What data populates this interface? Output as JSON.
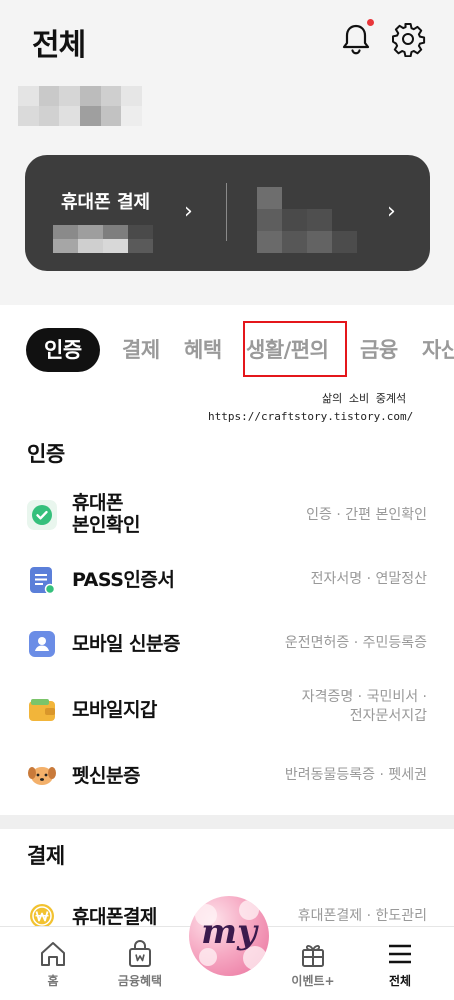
{
  "header": {
    "title": "전체"
  },
  "card": {
    "label": "휴대폰 결제",
    "chevron": "›"
  },
  "tabs": [
    {
      "label": "인증",
      "active": true
    },
    {
      "label": "결제"
    },
    {
      "label": "혜택"
    },
    {
      "label": "생활/편의",
      "highlighted": true
    },
    {
      "label": "금융"
    },
    {
      "label": "자산"
    }
  ],
  "watermark": {
    "line1": "삶의 소비 중계석",
    "line2": "https://craftstory.tistory.com/"
  },
  "sections": {
    "auth": {
      "title": "인증",
      "items": [
        {
          "label": "휴대폰\n본인확인",
          "desc": "인증 · 간편 본인확인",
          "icon": "check-shield-icon"
        },
        {
          "label": "PASS인증서",
          "desc": "전자서명 · 연말정산",
          "icon": "document-icon"
        },
        {
          "label": "모바일 신분증",
          "desc": "운전면허증 · 주민등록증",
          "icon": "id-card-icon"
        },
        {
          "label": "모바일지갑",
          "desc": "자격증명 · 국민비서 ·\n전자문서지갑",
          "icon": "wallet-icon"
        },
        {
          "label": "펫신분증",
          "desc": "반려동물등록증 · 펫세권",
          "icon": "dog-icon"
        }
      ]
    },
    "payment": {
      "title": "결제",
      "items": [
        {
          "label": "휴대폰결제",
          "desc": "휴대폰결제 · 한도관리",
          "icon": "won-coin-icon"
        }
      ]
    }
  },
  "badge": {
    "text": "my"
  },
  "nav": [
    {
      "label": "홈",
      "icon": "home-icon"
    },
    {
      "label": "금융혜택",
      "icon": "bag-icon"
    },
    {
      "label": "이벤트+",
      "icon": "gift-icon"
    },
    {
      "label": "전체",
      "icon": "menu-icon",
      "active": true
    }
  ],
  "colors": {
    "accent_red": "#e4161b",
    "card_bg": "#3d3d3d",
    "text_dark": "#111111"
  }
}
